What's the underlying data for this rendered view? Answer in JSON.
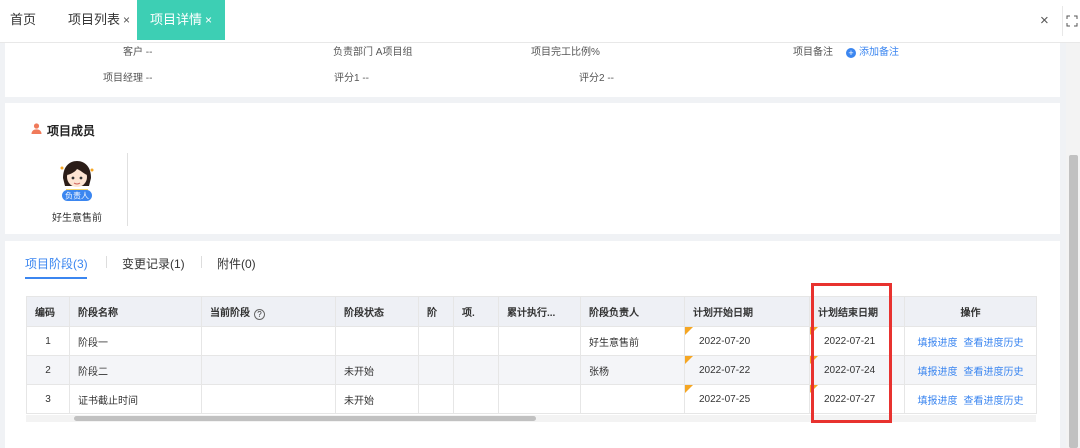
{
  "tabs": {
    "home": "首页",
    "list": "项目列表",
    "detail": "项目详情",
    "close_glyph": "×"
  },
  "info": {
    "customer": "客户 --",
    "department": "负责部门 A项目组",
    "completion": "项目完工比例%",
    "note_label": "项目备注",
    "add_note": "添加备注",
    "manager": "项目经理 --",
    "score1": "评分1 --",
    "score2": "评分2 --"
  },
  "members": {
    "title": "项目成员",
    "badge": "负责人",
    "items": [
      {
        "name": "好生意售前"
      }
    ]
  },
  "stages": {
    "tabs": [
      "项目阶段(3)",
      "变更记录(1)",
      "附件(0)"
    ],
    "columns": [
      "编码",
      "阶段名称",
      "当前阶段",
      "阶段状态",
      "阶",
      "项.",
      "累计执行...",
      "阶段负责人",
      "计划开始日期",
      "计划结束日期",
      "操作"
    ],
    "rows": [
      {
        "code": "1",
        "name": "阶段一",
        "current": "",
        "status": "",
        "c5": "",
        "c6": "",
        "c7": "",
        "owner": "好生意售前",
        "start": "2022-07-20",
        "end": "2022-07-21"
      },
      {
        "code": "2",
        "name": "阶段二",
        "current": "",
        "status": "未开始",
        "c5": "",
        "c6": "",
        "c7": "",
        "owner": "张杨",
        "start": "2022-07-22",
        "end": "2022-07-24"
      },
      {
        "code": "3",
        "name": "证书截止时间",
        "current": "",
        "status": "未开始",
        "c5": "",
        "c6": "",
        "c7": "",
        "owner": "",
        "start": "2022-07-25",
        "end": "2022-07-27"
      }
    ],
    "actions": {
      "fill": "填报进度",
      "history": "查看进度历史"
    }
  },
  "colors": {
    "accent": "#3dcfb4",
    "link": "#3b86f0",
    "highlight": "#e8322f",
    "flag": "#f5a623"
  }
}
